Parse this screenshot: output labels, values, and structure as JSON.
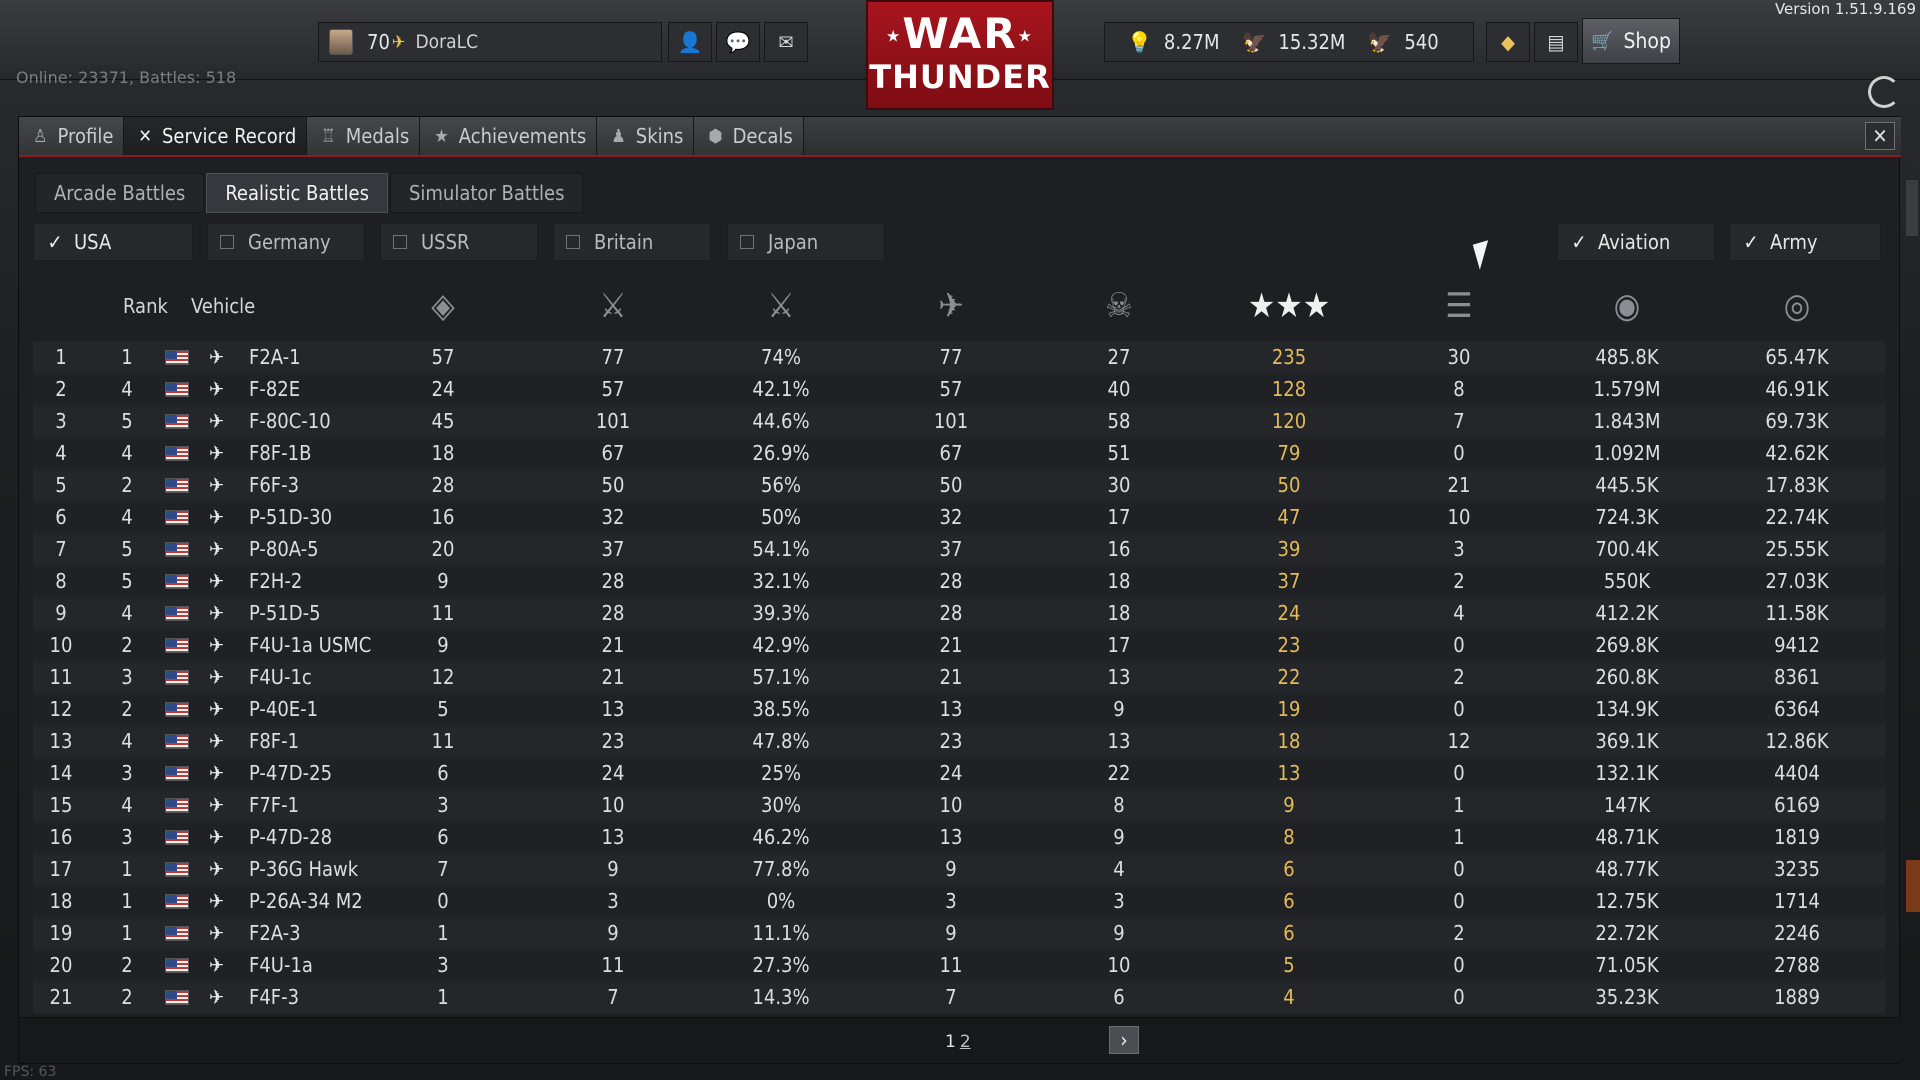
{
  "version": "Version 1.51.9.169",
  "player": {
    "level": "70",
    "name": "DoraLC"
  },
  "currency": {
    "silver_lions": "8.27M",
    "research": "15.32M",
    "golden_eagles": "540"
  },
  "shop_label": "Shop",
  "online_text": "Online: 23371, Battles: 518",
  "logo": {
    "line1": "WAR",
    "line2": "THUNDER"
  },
  "tabs": [
    {
      "label": "Profile",
      "icon": "profile-icon"
    },
    {
      "label": "Service Record",
      "icon": "service-record-icon"
    },
    {
      "label": "Medals",
      "icon": "medal-icon"
    },
    {
      "label": "Achievements",
      "icon": "star-icon"
    },
    {
      "label": "Skins",
      "icon": "skin-icon"
    },
    {
      "label": "Decals",
      "icon": "decal-icon"
    }
  ],
  "mode_tabs": [
    "Arcade Battles",
    "Realistic Battles",
    "Simulator Battles"
  ],
  "active_mode": "Realistic Battles",
  "nation_filters": [
    {
      "label": "USA",
      "checked": true
    },
    {
      "label": "Germany",
      "checked": false
    },
    {
      "label": "USSR",
      "checked": false
    },
    {
      "label": "Britain",
      "checked": false
    },
    {
      "label": "Japan",
      "checked": false
    }
  ],
  "type_filters": [
    {
      "label": "Aviation",
      "checked": true
    },
    {
      "label": "Army",
      "checked": true
    }
  ],
  "columns": {
    "rank": "Rank",
    "vehicle": "Vehicle",
    "icon_columns": [
      "victories-icon",
      "sessions-icon",
      "win-rate-icon",
      "flyouts-icon",
      "deaths-icon",
      "air-kills-icon",
      "ground-kills-icon",
      "lion-icon",
      "research-icon"
    ]
  },
  "rows": [
    {
      "n": "1",
      "rank": "1",
      "vehicle": "F2A-1",
      "c1": "57",
      "c2": "77",
      "c3": "74%",
      "c4": "77",
      "c5": "27",
      "c6": "235",
      "c7": "30",
      "c8": "485.8K",
      "c9": "65.47K"
    },
    {
      "n": "2",
      "rank": "4",
      "vehicle": "F-82E",
      "c1": "24",
      "c2": "57",
      "c3": "42.1%",
      "c4": "57",
      "c5": "40",
      "c6": "128",
      "c7": "8",
      "c8": "1.579M",
      "c9": "46.91K"
    },
    {
      "n": "3",
      "rank": "5",
      "vehicle": "F-80C-10",
      "c1": "45",
      "c2": "101",
      "c3": "44.6%",
      "c4": "101",
      "c5": "58",
      "c6": "120",
      "c7": "7",
      "c8": "1.843M",
      "c9": "69.73K"
    },
    {
      "n": "4",
      "rank": "4",
      "vehicle": "F8F-1B",
      "c1": "18",
      "c2": "67",
      "c3": "26.9%",
      "c4": "67",
      "c5": "51",
      "c6": "79",
      "c7": "0",
      "c8": "1.092M",
      "c9": "42.62K"
    },
    {
      "n": "5",
      "rank": "2",
      "vehicle": "F6F-3",
      "c1": "28",
      "c2": "50",
      "c3": "56%",
      "c4": "50",
      "c5": "30",
      "c6": "50",
      "c7": "21",
      "c8": "445.5K",
      "c9": "17.83K"
    },
    {
      "n": "6",
      "rank": "4",
      "vehicle": "P-51D-30",
      "c1": "16",
      "c2": "32",
      "c3": "50%",
      "c4": "32",
      "c5": "17",
      "c6": "47",
      "c7": "10",
      "c8": "724.3K",
      "c9": "22.74K"
    },
    {
      "n": "7",
      "rank": "5",
      "vehicle": "P-80A-5",
      "c1": "20",
      "c2": "37",
      "c3": "54.1%",
      "c4": "37",
      "c5": "16",
      "c6": "39",
      "c7": "3",
      "c8": "700.4K",
      "c9": "25.55K"
    },
    {
      "n": "8",
      "rank": "5",
      "vehicle": "F2H-2",
      "c1": "9",
      "c2": "28",
      "c3": "32.1%",
      "c4": "28",
      "c5": "18",
      "c6": "37",
      "c7": "2",
      "c8": "550K",
      "c9": "27.03K"
    },
    {
      "n": "9",
      "rank": "4",
      "vehicle": "P-51D-5",
      "c1": "11",
      "c2": "28",
      "c3": "39.3%",
      "c4": "28",
      "c5": "18",
      "c6": "24",
      "c7": "4",
      "c8": "412.2K",
      "c9": "11.58K"
    },
    {
      "n": "10",
      "rank": "2",
      "vehicle": "F4U-1a USMC",
      "c1": "9",
      "c2": "21",
      "c3": "42.9%",
      "c4": "21",
      "c5": "17",
      "c6": "23",
      "c7": "0",
      "c8": "269.8K",
      "c9": "9412"
    },
    {
      "n": "11",
      "rank": "3",
      "vehicle": "F4U-1c",
      "c1": "12",
      "c2": "21",
      "c3": "57.1%",
      "c4": "21",
      "c5": "13",
      "c6": "22",
      "c7": "2",
      "c8": "260.8K",
      "c9": "8361"
    },
    {
      "n": "12",
      "rank": "2",
      "vehicle": "P-40E-1",
      "c1": "5",
      "c2": "13",
      "c3": "38.5%",
      "c4": "13",
      "c5": "9",
      "c6": "19",
      "c7": "0",
      "c8": "134.9K",
      "c9": "6364"
    },
    {
      "n": "13",
      "rank": "4",
      "vehicle": "F8F-1",
      "c1": "11",
      "c2": "23",
      "c3": "47.8%",
      "c4": "23",
      "c5": "13",
      "c6": "18",
      "c7": "12",
      "c8": "369.1K",
      "c9": "12.86K"
    },
    {
      "n": "14",
      "rank": "3",
      "vehicle": "P-47D-25",
      "c1": "6",
      "c2": "24",
      "c3": "25%",
      "c4": "24",
      "c5": "22",
      "c6": "13",
      "c7": "0",
      "c8": "132.1K",
      "c9": "4404"
    },
    {
      "n": "15",
      "rank": "4",
      "vehicle": "F7F-1",
      "c1": "3",
      "c2": "10",
      "c3": "30%",
      "c4": "10",
      "c5": "8",
      "c6": "9",
      "c7": "1",
      "c8": "147K",
      "c9": "6169"
    },
    {
      "n": "16",
      "rank": "3",
      "vehicle": "P-47D-28",
      "c1": "6",
      "c2": "13",
      "c3": "46.2%",
      "c4": "13",
      "c5": "9",
      "c6": "8",
      "c7": "1",
      "c8": "48.71K",
      "c9": "1819"
    },
    {
      "n": "17",
      "rank": "1",
      "vehicle": "P-36G Hawk",
      "c1": "7",
      "c2": "9",
      "c3": "77.8%",
      "c4": "9",
      "c5": "4",
      "c6": "6",
      "c7": "0",
      "c8": "48.77K",
      "c9": "3235"
    },
    {
      "n": "18",
      "rank": "1",
      "vehicle": "P-26A-34 M2",
      "c1": "0",
      "c2": "3",
      "c3": "0%",
      "c4": "3",
      "c5": "3",
      "c6": "6",
      "c7": "0",
      "c8": "12.75K",
      "c9": "1714"
    },
    {
      "n": "19",
      "rank": "1",
      "vehicle": "F2A-3",
      "c1": "1",
      "c2": "9",
      "c3": "11.1%",
      "c4": "9",
      "c5": "9",
      "c6": "6",
      "c7": "2",
      "c8": "22.72K",
      "c9": "2246"
    },
    {
      "n": "20",
      "rank": "2",
      "vehicle": "F4U-1a",
      "c1": "3",
      "c2": "11",
      "c3": "27.3%",
      "c4": "11",
      "c5": "10",
      "c6": "5",
      "c7": "0",
      "c8": "71.05K",
      "c9": "2788"
    },
    {
      "n": "21",
      "rank": "2",
      "vehicle": "F4F-3",
      "c1": "1",
      "c2": "7",
      "c3": "14.3%",
      "c4": "7",
      "c5": "6",
      "c6": "4",
      "c7": "0",
      "c8": "35.23K",
      "c9": "1889"
    }
  ],
  "pagination": {
    "page1": "1",
    "page2": "2"
  },
  "fps": "FPS: 63",
  "colors": {
    "accent_red": "#8d1b1f",
    "highlight_gold": "#e5bb56",
    "logo_red": "#a8151e"
  }
}
